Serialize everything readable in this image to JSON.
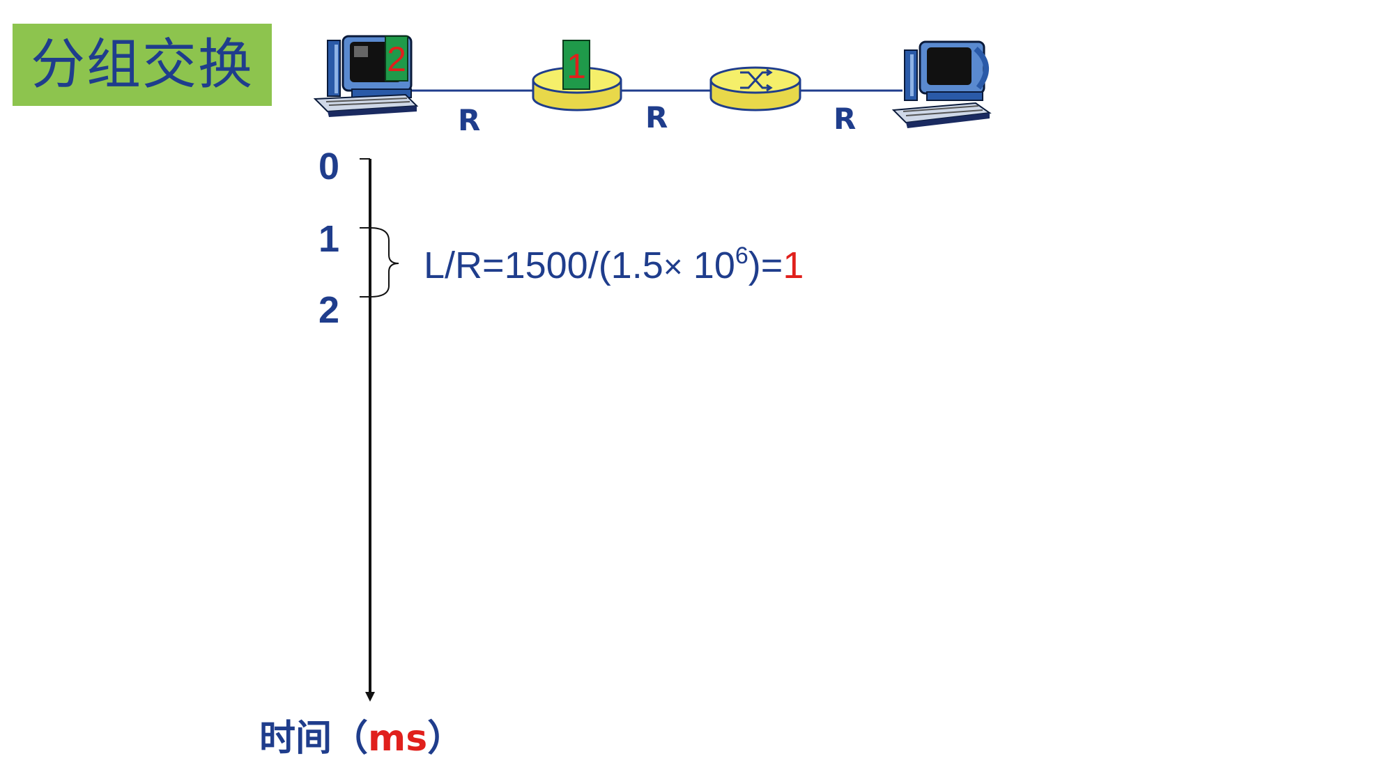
{
  "title": "分组交换",
  "links": [
    {
      "label": "R"
    },
    {
      "label": "R"
    },
    {
      "label": "R"
    }
  ],
  "packets": {
    "at_source": "2",
    "at_router1": "1"
  },
  "timeline": {
    "ticks": [
      "0",
      "1",
      "2"
    ],
    "formula": {
      "prefix": "L/R=1500/(1.5",
      "times": "×",
      "base": " 10",
      "exponent": "6",
      "suffix": ")=",
      "result": "1"
    },
    "axis_label_prefix": "时间（",
    "axis_label_unit": "ms",
    "axis_label_suffix": "）"
  },
  "colors": {
    "title_bg": "#8dc44e",
    "text_blue": "#1f3d8c",
    "accent_red": "#e0201c",
    "packet_green": "#1f9a4a",
    "router_yellow": "#f5ef6a"
  }
}
